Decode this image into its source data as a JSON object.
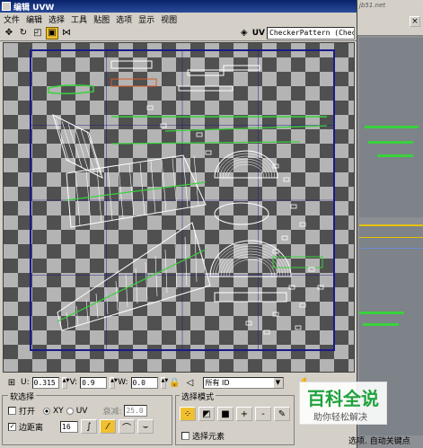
{
  "window": {
    "title": "编辑 UVW"
  },
  "menu": [
    "文件",
    "编辑",
    "选择",
    "工具",
    "贴图",
    "选项",
    "显示",
    "视图"
  ],
  "toolbar": {
    "tools": [
      "move-icon",
      "rotate-icon",
      "scale-icon",
      "freeform-icon",
      "mirror-icon"
    ],
    "uv_label": "UV",
    "texture_value": "CheckerPattern  (Checker)"
  },
  "coords": {
    "u_label": "U:",
    "u_value": "0.315",
    "v_label": "V:",
    "v_value": "0.9",
    "w_label": "W:",
    "w_value": "0.0",
    "id_filter": "所有 ID"
  },
  "soft_selection": {
    "title": "软选择",
    "open_label": "打开",
    "xy_label": "XY",
    "uv_label": "UV",
    "falloff_label": "衰减:",
    "falloff_value": "25.0",
    "edge_distance_label": "边距离",
    "edge_distance_checked": true,
    "edge_distance_value": "16"
  },
  "selection_modes": {
    "title": "选择模式",
    "select_elements_label": "选择元素",
    "plus_label": "+",
    "minus_label": "-"
  },
  "watermark": {
    "title": "百科全说",
    "subtitle": "助你轻松解决"
  },
  "status": {
    "select_label": "选项.",
    "keys_label": "自动关键点"
  },
  "corner_text": "jb51.net",
  "colors": {
    "uv_wire": "#ffffff",
    "uv_selected": "#39d23c",
    "checker_dark": "#505050",
    "checker_light": "#b4b4b4",
    "frame": "#1a1a8a"
  }
}
